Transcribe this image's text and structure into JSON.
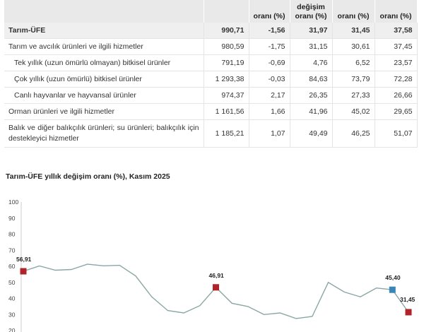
{
  "table": {
    "headers": [
      "",
      "",
      "oranı (%)",
      "değişim oranı (%)",
      "oranı (%)",
      "oranı (%)"
    ],
    "rows": [
      {
        "label": "Tarım-ÜFE",
        "v1": "990,71",
        "v2": "-1,56",
        "v3": "31,97",
        "v4": "31,45",
        "v5": "37,58",
        "kind": "total"
      },
      {
        "label": "Tarım ve avcılık ürünleri ve ilgili hizmetler",
        "v1": "980,59",
        "v2": "-1,75",
        "v3": "31,15",
        "v4": "30,61",
        "v5": "37,45",
        "kind": "main"
      },
      {
        "label": "Tek yıllık (uzun ömürlü olmayan) bitkisel ürünler",
        "v1": "791,19",
        "v2": "-0,69",
        "v3": "4,76",
        "v4": "6,52",
        "v5": "23,57",
        "kind": "sub"
      },
      {
        "label": "Çok yıllık (uzun ömürlü) bitkisel ürünler",
        "v1": "1 293,38",
        "v2": "-0,03",
        "v3": "84,63",
        "v4": "73,79",
        "v5": "72,28",
        "kind": "sub"
      },
      {
        "label": "Canlı hayvanlar ve hayvansal ürünler",
        "v1": "974,37",
        "v2": "2,17",
        "v3": "26,35",
        "v4": "27,33",
        "v5": "26,66",
        "kind": "sub"
      },
      {
        "label": "Orman ürünleri ve ilgili hizmetler",
        "v1": "1 161,56",
        "v2": "1,66",
        "v3": "41,96",
        "v4": "45,02",
        "v5": "29,65",
        "kind": "main"
      },
      {
        "label": "Balık ve diğer balıkçılık ürünleri; su ürünleri; balıkçılık için destekleyici hizmetler",
        "v1": "1 185,21",
        "v2": "1,07",
        "v3": "49,49",
        "v4": "46,25",
        "v5": "51,07",
        "kind": "tall"
      }
    ]
  },
  "chart_data": {
    "type": "line",
    "title": "Tarım-ÜFE yıllık değişim oranı (%), Kasım 2025",
    "xlabel": "",
    "ylabel": "",
    "ylim": [
      20,
      100
    ],
    "yticks": [
      20,
      30,
      40,
      50,
      60,
      70,
      80,
      90,
      100
    ],
    "grid": false,
    "line_color": "#8aa7a5",
    "marker_red": "#b0232a",
    "marker_blue": "#3a86b8",
    "series": [
      {
        "name": "",
        "values": [
          56.91,
          60.2,
          57.6,
          58.0,
          61.3,
          60.3,
          60.6,
          54.0,
          41.0,
          32.5,
          31.0,
          35.5,
          46.91,
          37.0,
          35.0,
          30.0,
          31.0,
          27.5,
          28.8,
          50.0,
          44.0,
          41.0,
          46.5,
          45.4,
          31.45
        ]
      }
    ],
    "markers": [
      {
        "index": 0,
        "label": "56,91",
        "color": "red"
      },
      {
        "index": 12,
        "label": "46,91",
        "color": "red"
      },
      {
        "index": 23,
        "label": "45,40",
        "color": "blue"
      },
      {
        "index": 24,
        "label": "31,45",
        "color": "red"
      }
    ]
  }
}
